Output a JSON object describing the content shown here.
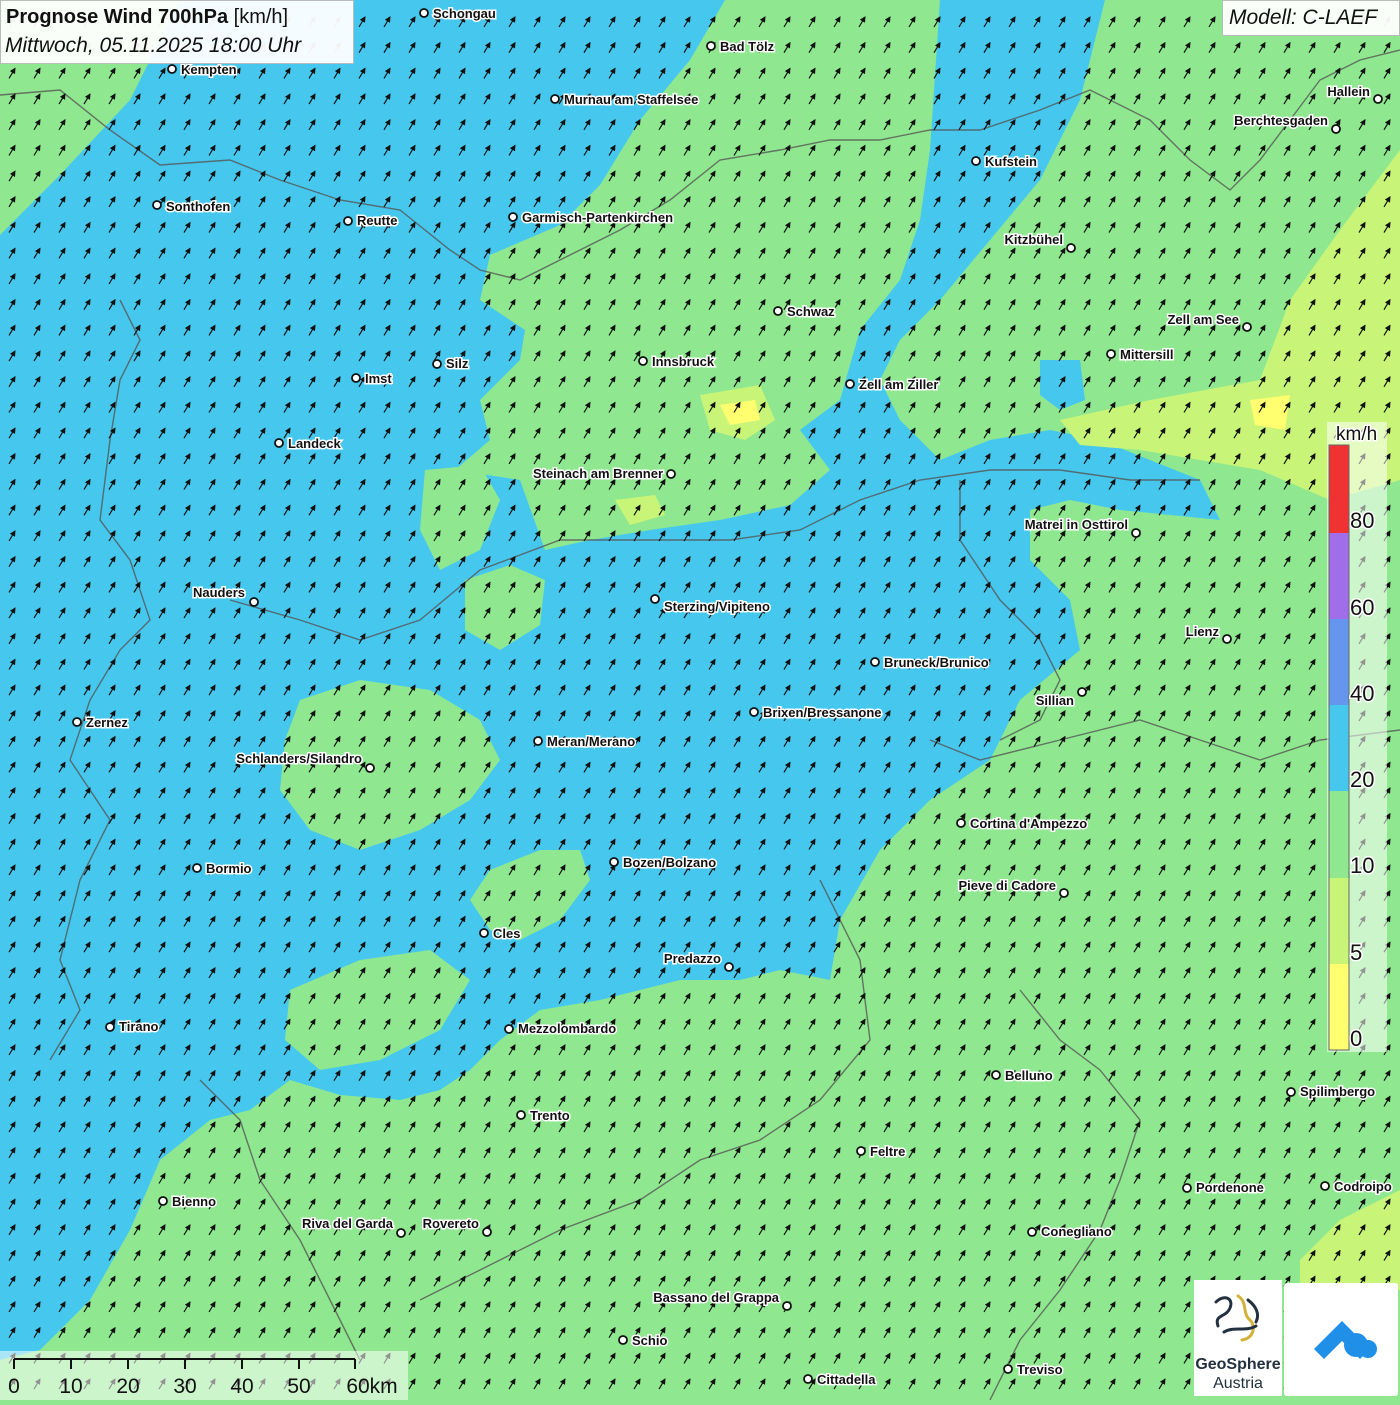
{
  "header": {
    "title_bold": "Prognose Wind 700hPa",
    "title_unit": "[km/h]",
    "datetime": "Mittwoch, 05.11.2025 18:00 Uhr",
    "model": "Modell: C-LAEF"
  },
  "colors": {
    "wind_0_5": "#ffff70",
    "wind_5_10": "#c8f578",
    "wind_10_20": "#8fe88f",
    "wind_20_40": "#46c8ee",
    "wind_40_60": "#6596ee",
    "wind_60_80": "#9f6ee8",
    "wind_80_plus": "#f03232",
    "arrows": "#111111",
    "borders": "#555555"
  },
  "legend": {
    "unit": "km/h",
    "ticks": [
      "0",
      "5",
      "10",
      "20",
      "40",
      "60",
      "80"
    ]
  },
  "scale_bar": {
    "ticks": [
      "0",
      "10",
      "20",
      "30",
      "40",
      "50",
      "60km"
    ]
  },
  "cities": [
    {
      "name": "Schongau"
    },
    {
      "name": "Bad Tölz"
    },
    {
      "name": "Kempten"
    },
    {
      "name": "Murnau am Staffelsee"
    },
    {
      "name": "Hallein"
    },
    {
      "name": "Berchtesgaden"
    },
    {
      "name": "Kufstein"
    },
    {
      "name": "Sonthofen"
    },
    {
      "name": "Reutte"
    },
    {
      "name": "Garmisch-Partenkirchen"
    },
    {
      "name": "Kitzbühel"
    },
    {
      "name": "Schwaz"
    },
    {
      "name": "Zell am See"
    },
    {
      "name": "Mittersill"
    },
    {
      "name": "Silz"
    },
    {
      "name": "Innsbruck"
    },
    {
      "name": "Imst"
    },
    {
      "name": "Zell am Ziller"
    },
    {
      "name": "Landeck"
    },
    {
      "name": "Steinach am Brenner"
    },
    {
      "name": "Matrei in Osttirol"
    },
    {
      "name": "Nauders"
    },
    {
      "name": "Sterzing/Vipiteno"
    },
    {
      "name": "Lienz"
    },
    {
      "name": "Bruneck/Brunico"
    },
    {
      "name": "Sillian"
    },
    {
      "name": "Brixen/Bressanone"
    },
    {
      "name": "Zernez"
    },
    {
      "name": "Meran/Merano"
    },
    {
      "name": "Schlanders/Silandro"
    },
    {
      "name": "Cortina d'Ampezzo"
    },
    {
      "name": "Bozen/Bolzano"
    },
    {
      "name": "Bormio"
    },
    {
      "name": "Pieve di Cadore"
    },
    {
      "name": "Cles"
    },
    {
      "name": "Predazzo"
    },
    {
      "name": "Tirano"
    },
    {
      "name": "Mezzolombardo"
    },
    {
      "name": "Belluno"
    },
    {
      "name": "Spilimbergo"
    },
    {
      "name": "Trento"
    },
    {
      "name": "Feltre"
    },
    {
      "name": "Pordenone"
    },
    {
      "name": "Codroipo"
    },
    {
      "name": "Bienno"
    },
    {
      "name": "Riva del Garda"
    },
    {
      "name": "Rovereto"
    },
    {
      "name": "Conegliano"
    },
    {
      "name": "Bassano del Grappa"
    },
    {
      "name": "Schio"
    },
    {
      "name": "Treviso"
    },
    {
      "name": "Cittadella"
    }
  ],
  "logos": {
    "geosphere_name": "GeoSphere",
    "geosphere_sub": "Austria",
    "app_icon": "weather-app-icon"
  }
}
